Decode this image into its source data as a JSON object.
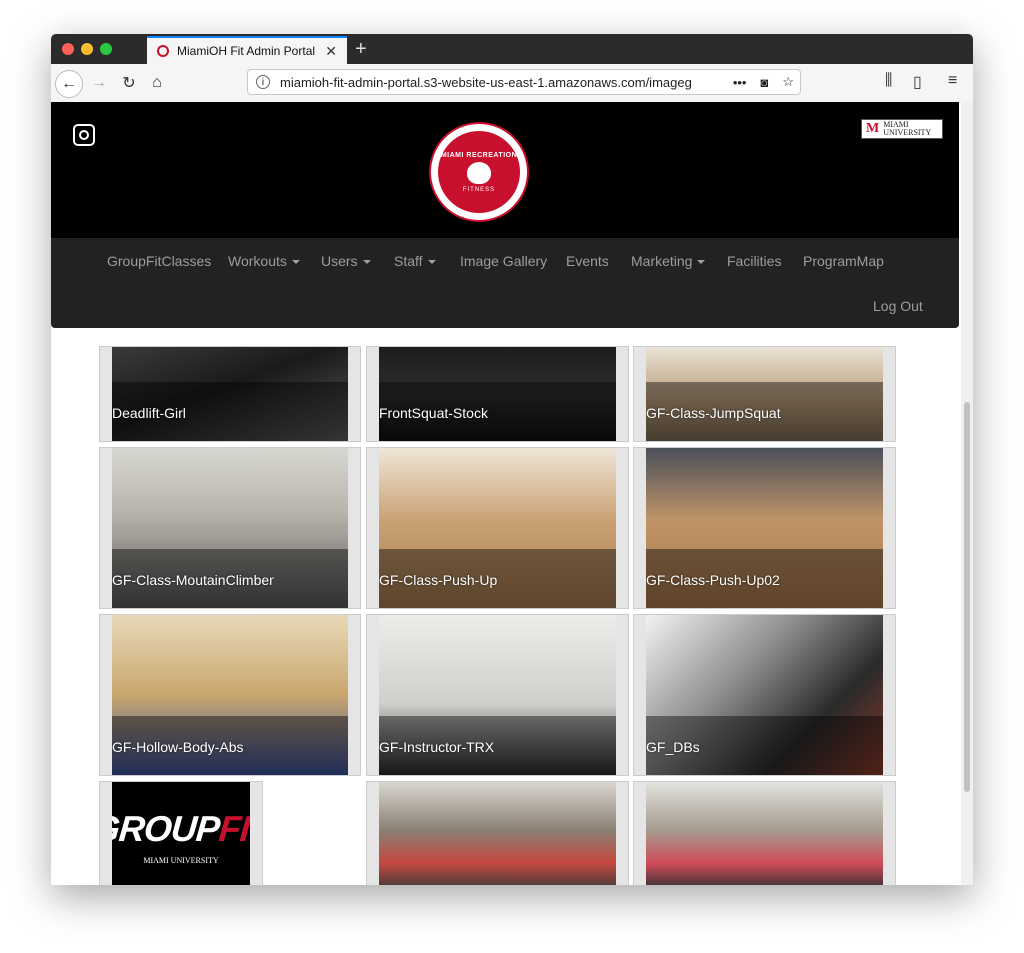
{
  "browser": {
    "tab_title": "MiamiOH Fit Admin Portal",
    "tab_close": "✕",
    "new_tab": "+",
    "url": "miamioh-fit-admin-portal.s3-website-us-east-1.amazonaws.com/imageg",
    "more": "•••"
  },
  "header": {
    "logo_top": "MIAMI RECREATION",
    "logo_bottom": "FITNESS",
    "mu_badge": "MIAMI UNIVERSITY",
    "mu_letter": "M"
  },
  "nav": {
    "groupfit": "GroupFitClasses",
    "workouts": "Workouts",
    "users": "Users",
    "staff": "Staff",
    "gallery": "Image Gallery",
    "events": "Events",
    "marketing": "Marketing",
    "facilities": "Facilities",
    "programmap": "ProgramMap",
    "logout": "Log Out"
  },
  "gallery": {
    "items": [
      {
        "caption": "Deadlift-Girl"
      },
      {
        "caption": "FrontSquat-Stock"
      },
      {
        "caption": "GF-Class-JumpSquat"
      },
      {
        "caption": "GF-Class-MoutainClimber"
      },
      {
        "caption": "GF-Class-Push-Up"
      },
      {
        "caption": "GF-Class-Push-Up02"
      },
      {
        "caption": "GF-Hollow-Body-Abs"
      },
      {
        "caption": "GF-Instructor-TRX"
      },
      {
        "caption": "GF_DBs"
      }
    ],
    "groupfit_logo": {
      "group": "GROUP",
      "fit": "FIT",
      "sub": "MIAMI UNIVERSITY"
    }
  },
  "colors": {
    "accent": "#c8102e",
    "navbar": "#222222",
    "header": "#000000"
  }
}
